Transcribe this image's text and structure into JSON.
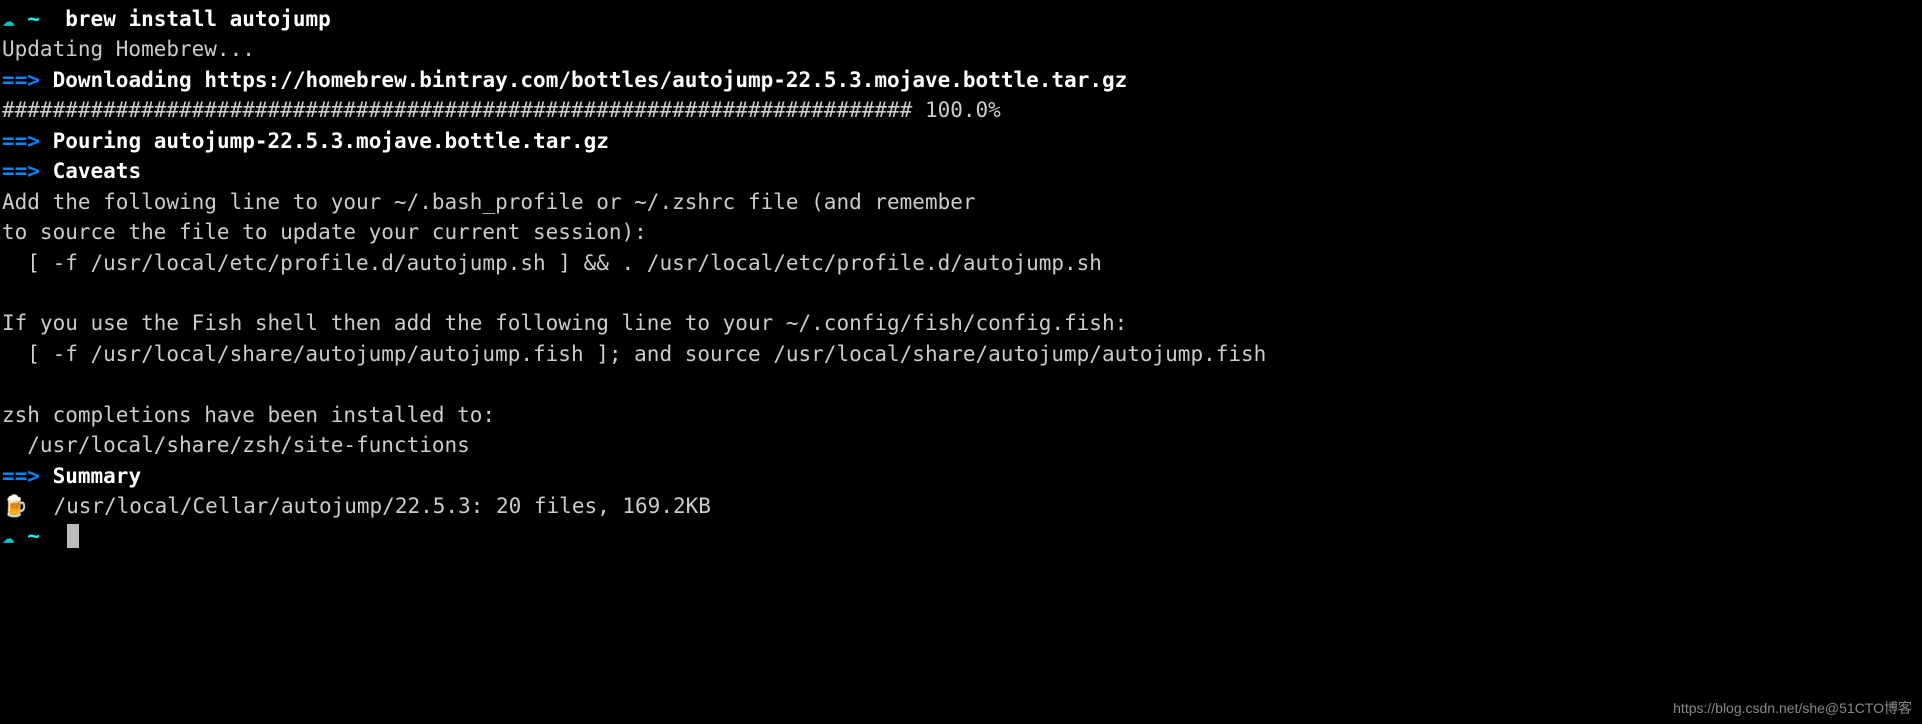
{
  "prompt": {
    "cloud": "☁",
    "tilde": "~",
    "command": "brew install autojump"
  },
  "updating": "Updating Homebrew...",
  "arrow": "==>",
  "downloading": {
    "label": "Downloading",
    "url": "https://homebrew.bintray.com/bottles/autojump-22.5.3.mojave.bottle.tar.gz"
  },
  "progress": "######################################################################## 100.0%",
  "pouring": {
    "label": "Pouring",
    "file": "autojump-22.5.3.mojave.bottle.tar.gz"
  },
  "caveats_label": "Caveats",
  "caveats_line1": "Add the following line to your ~/.bash_profile or ~/.zshrc file (and remember",
  "caveats_line2": "to source the file to update your current session):",
  "caveats_line3": "  [ -f /usr/local/etc/profile.d/autojump.sh ] && . /usr/local/etc/profile.d/autojump.sh",
  "caveats_fish1": "If you use the Fish shell then add the following line to your ~/.config/fish/config.fish:",
  "caveats_fish2": "  [ -f /usr/local/share/autojump/autojump.fish ]; and source /usr/local/share/autojump/autojump.fish",
  "zsh_line1": "zsh completions have been installed to:",
  "zsh_line2": "  /usr/local/share/zsh/site-functions",
  "summary_label": "Summary",
  "beer": "🍺",
  "summary_path": "/usr/local/Cellar/autojump/22.5.3: 20 files, 169.2KB",
  "watermark": "https://blog.csdn.net/she@51CTO博客"
}
